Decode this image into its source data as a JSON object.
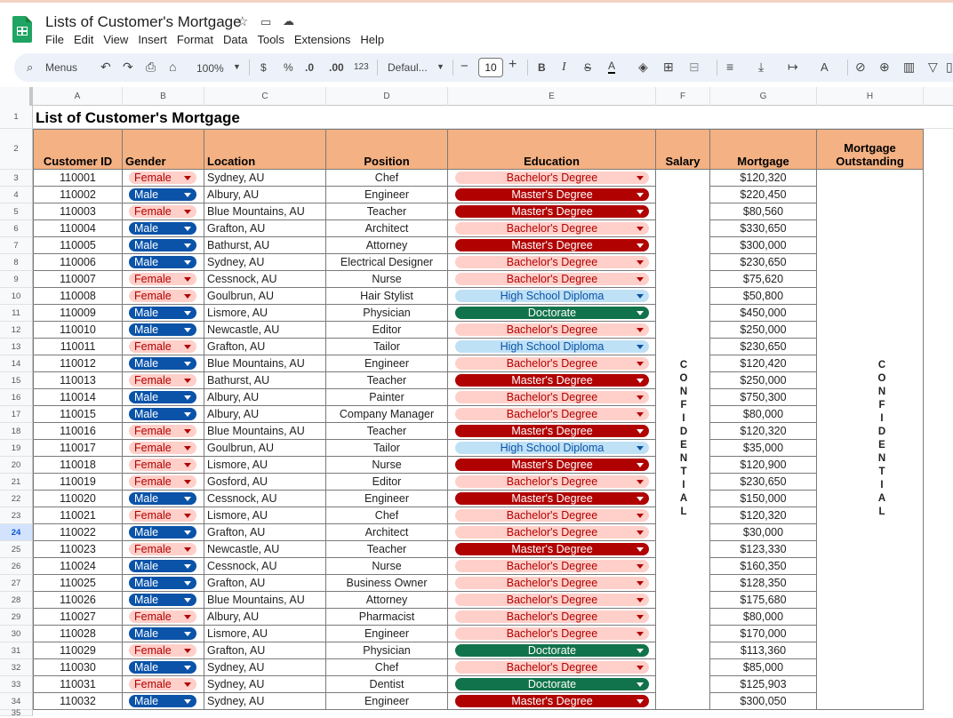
{
  "app": {
    "doc_title": "Lists of Customer's Mortgage",
    "menus": [
      "File",
      "Edit",
      "View",
      "Insert",
      "Format",
      "Data",
      "Tools",
      "Extensions",
      "Help"
    ]
  },
  "toolbar": {
    "menus_label": "Menus",
    "zoom": "100%",
    "currency": "$",
    "percent": "%",
    "dec_decrease": ".0",
    "dec_increase": ".00",
    "number_format": "123",
    "font": "Defaul...",
    "font_size": "10",
    "bold": "B",
    "italic": "I",
    "strike": "S",
    "text_color": "A"
  },
  "columns": [
    "A",
    "B",
    "C",
    "D",
    "E",
    "F",
    "G",
    "H"
  ],
  "sheet": {
    "title": "List of Customer's Mortgage",
    "headers": {
      "customer_id": "Customer ID",
      "gender": "Gender",
      "location": "Location",
      "position": "Position",
      "education": "Education",
      "salary": "Salary",
      "mortgage": "Mortgage",
      "mortgage_outstanding": "Mortgage Outstanding"
    },
    "confidential_letters": [
      "C",
      "O",
      "N",
      "F",
      "I",
      "D",
      "E",
      "N",
      "T",
      "I",
      "A",
      "L"
    ],
    "selected_row": "24",
    "rows": [
      [
        "110001",
        "Female",
        "Sydney, AU",
        "Chef",
        "Bachelor's Degree",
        "$120,320"
      ],
      [
        "110002",
        "Male",
        "Albury, AU",
        "Engineer",
        "Master's Degree",
        "$220,450"
      ],
      [
        "110003",
        "Female",
        "Blue Mountains, AU",
        "Teacher",
        "Master's Degree",
        "$80,560"
      ],
      [
        "110004",
        "Male",
        "Grafton, AU",
        "Architect",
        "Bachelor's Degree",
        "$330,650"
      ],
      [
        "110005",
        "Male",
        "Bathurst, AU",
        "Attorney",
        "Master's Degree",
        "$300,000"
      ],
      [
        "110006",
        "Male",
        "Sydney, AU",
        "Electrical Designer",
        "Bachelor's Degree",
        "$230,650"
      ],
      [
        "110007",
        "Female",
        "Cessnock, AU",
        "Nurse",
        "Bachelor's Degree",
        "$75,620"
      ],
      [
        "110008",
        "Female",
        "Goulbrun, AU",
        "Hair Stylist",
        "High School Diploma",
        "$50,800"
      ],
      [
        "110009",
        "Male",
        "Lismore, AU",
        "Physician",
        "Doctorate",
        "$450,000"
      ],
      [
        "110010",
        "Male",
        "Newcastle, AU",
        "Editor",
        "Bachelor's Degree",
        "$250,000"
      ],
      [
        "110011",
        "Female",
        "Grafton, AU",
        "Tailor",
        "High School Diploma",
        "$230,650"
      ],
      [
        "110012",
        "Male",
        "Blue Mountains, AU",
        "Engineer",
        "Bachelor's Degree",
        "$120,420"
      ],
      [
        "110013",
        "Female",
        "Bathurst, AU",
        "Teacher",
        "Master's Degree",
        "$250,000"
      ],
      [
        "110014",
        "Male",
        "Albury, AU",
        "Painter",
        "Bachelor's Degree",
        "$750,300"
      ],
      [
        "110015",
        "Male",
        "Albury, AU",
        "Company Manager",
        "Bachelor's Degree",
        "$80,000"
      ],
      [
        "110016",
        "Female",
        "Blue Mountains, AU",
        "Teacher",
        "Master's Degree",
        "$120,320"
      ],
      [
        "110017",
        "Female",
        "Goulbrun, AU",
        "Tailor",
        "High School Diploma",
        "$35,000"
      ],
      [
        "110018",
        "Female",
        "Lismore, AU",
        "Nurse",
        "Master's Degree",
        "$120,900"
      ],
      [
        "110019",
        "Female",
        "Gosford, AU",
        "Editor",
        "Bachelor's Degree",
        "$230,650"
      ],
      [
        "110020",
        "Male",
        "Cessnock, AU",
        "Engineer",
        "Master's Degree",
        "$150,000"
      ],
      [
        "110021",
        "Female",
        "Lismore, AU",
        "Chef",
        "Bachelor's Degree",
        "$120,320"
      ],
      [
        "110022",
        "Male",
        "Grafton, AU",
        "Architect",
        "Bachelor's Degree",
        "$30,000"
      ],
      [
        "110023",
        "Female",
        "Newcastle, AU",
        "Teacher",
        "Master's Degree",
        "$123,330"
      ],
      [
        "110024",
        "Male",
        "Cessnock, AU",
        "Nurse",
        "Bachelor's Degree",
        "$160,350"
      ],
      [
        "110025",
        "Male",
        "Grafton, AU",
        "Business Owner",
        "Bachelor's Degree",
        "$128,350"
      ],
      [
        "110026",
        "Male",
        "Blue Mountains, AU",
        "Attorney",
        "Bachelor's Degree",
        "$175,680"
      ],
      [
        "110027",
        "Female",
        "Albury, AU",
        "Pharmacist",
        "Bachelor's Degree",
        "$80,000"
      ],
      [
        "110028",
        "Male",
        "Lismore, AU",
        "Engineer",
        "Bachelor's Degree",
        "$170,000"
      ],
      [
        "110029",
        "Female",
        "Grafton, AU",
        "Physician",
        "Doctorate",
        "$113,360"
      ],
      [
        "110030",
        "Male",
        "Sydney, AU",
        "Chef",
        "Bachelor's Degree",
        "$85,000"
      ],
      [
        "110031",
        "Female",
        "Sydney, AU",
        "Dentist",
        "Doctorate",
        "$125,903"
      ],
      [
        "110032",
        "Male",
        "Sydney, AU",
        "Engineer",
        "Master's Degree",
        "$300,050"
      ]
    ]
  },
  "colors": {
    "header_fill": "#f4b183",
    "female_chip": "#ffcfc9",
    "male_chip": "#0a53a8",
    "masters_chip": "#b10202",
    "high_school_chip": "#bfe1f6",
    "doctorate_chip": "#11734b"
  }
}
